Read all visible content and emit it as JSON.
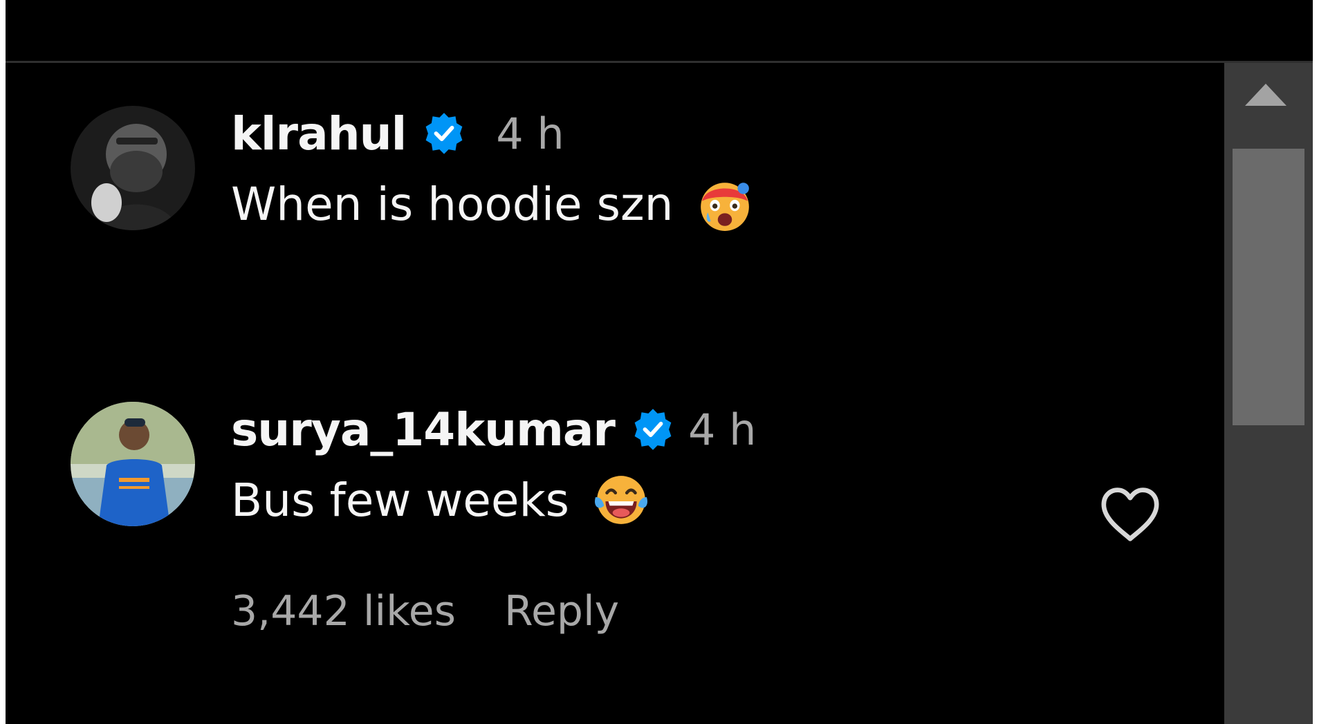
{
  "comments": [
    {
      "username": "klrahul",
      "verified": true,
      "time": "4 h",
      "text": "When is hoodie szn",
      "emoji": "hot-face-emoji"
    },
    {
      "username": "surya_14kumar",
      "verified": true,
      "time": "4 h",
      "text": "Bus few weeks",
      "emoji": "tears-of-joy-emoji",
      "likes": "3,442 likes",
      "reply_label": "Reply"
    }
  ],
  "colors": {
    "background": "#000000",
    "primary_text": "#f5f5f5",
    "secondary_text": "#a8a8a8",
    "verified_blue": "#0095f6",
    "scrollbar_track": "#3b3b3b",
    "scrollbar_thumb": "#6b6b6b"
  }
}
